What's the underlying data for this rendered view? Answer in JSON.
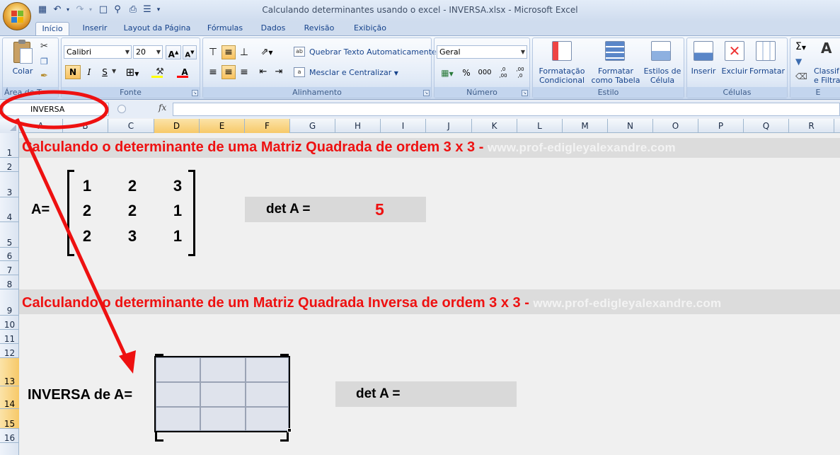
{
  "window": {
    "title": "Calculando determinantes usando o excel - INVERSA.xlsx - Microsoft Excel"
  },
  "qat_icons": [
    "save-icon",
    "undo-icon",
    "redo-icon",
    "new-document-icon",
    "print-preview-icon",
    "print-icon",
    "customize-qat-icon"
  ],
  "tabs": [
    "Início",
    "Inserir",
    "Layout da Página",
    "Fórmulas",
    "Dados",
    "Revisão",
    "Exibição"
  ],
  "active_tab": "Início",
  "ribbon": {
    "clipboard": {
      "paste": "Colar",
      "label": "Área de T"
    },
    "font": {
      "name": "Calibri",
      "size": "20",
      "bold": "N",
      "italic": "I",
      "underline": "S",
      "label": "Fonte",
      "grow": "A",
      "shrink": "A",
      "color_letter": "A"
    },
    "alignment": {
      "wrap": "Quebrar Texto Automaticamente",
      "merge": "Mesclar e Centralizar",
      "label": "Alinhamento"
    },
    "number": {
      "format": "Geral",
      "percent": "%",
      "thousands": "000",
      "inc_dec": ",0 ,00",
      "dec_dec": ",00 ,0",
      "label": "Número"
    },
    "styles": {
      "conditional": "Formatação\nCondicional",
      "as_table": "Formatar\ncomo Tabela",
      "cell_styles": "Estilos de\nCélula",
      "label": "Estilo"
    },
    "cells": {
      "insert": "Inserir",
      "delete": "Excluir",
      "format": "Formatar",
      "label": "Células"
    },
    "editing": {
      "sort": "Classif\ne Filtra",
      "label": "E"
    }
  },
  "formula_bar": {
    "name_box": "INVERSA",
    "fx": "fx",
    "formula": ""
  },
  "columns": [
    "A",
    "B",
    "C",
    "D",
    "E",
    "F",
    "G",
    "H",
    "I",
    "J",
    "K",
    "L",
    "M",
    "N",
    "O",
    "P",
    "Q",
    "R"
  ],
  "rows": [
    "1",
    "2",
    "3",
    "4",
    "5",
    "6",
    "7",
    "8",
    "9",
    "10",
    "11",
    "12",
    "13",
    "14",
    "15",
    "16"
  ],
  "selected_columns": [
    "D",
    "E",
    "F"
  ],
  "selected_rows": [
    "13",
    "14",
    "15"
  ],
  "sheet": {
    "heading1": "Calculando o determinante de uma Matriz Quadrada de ordem 3 x 3 -",
    "site1": "www.prof-edigleyalexandre.com",
    "heading2": "Calculando o determinante de um Matriz Quadrada Inversa de ordem 3 x 3 -",
    "site2": "www.prof-edigleyalexandre.com",
    "matrix_label": "A=",
    "matrix": [
      [
        "1",
        "2",
        "3"
      ],
      [
        "2",
        "2",
        "1"
      ],
      [
        "2",
        "3",
        "1"
      ]
    ],
    "det_label": "det A =",
    "det_value": "5",
    "inverse_label": "INVERSA de A=",
    "det2_label": "det A =",
    "det2_value": ""
  },
  "colors": {
    "accent_red": "#ee1111",
    "selection": "#f7c968",
    "band": "#dcdcdc"
  }
}
